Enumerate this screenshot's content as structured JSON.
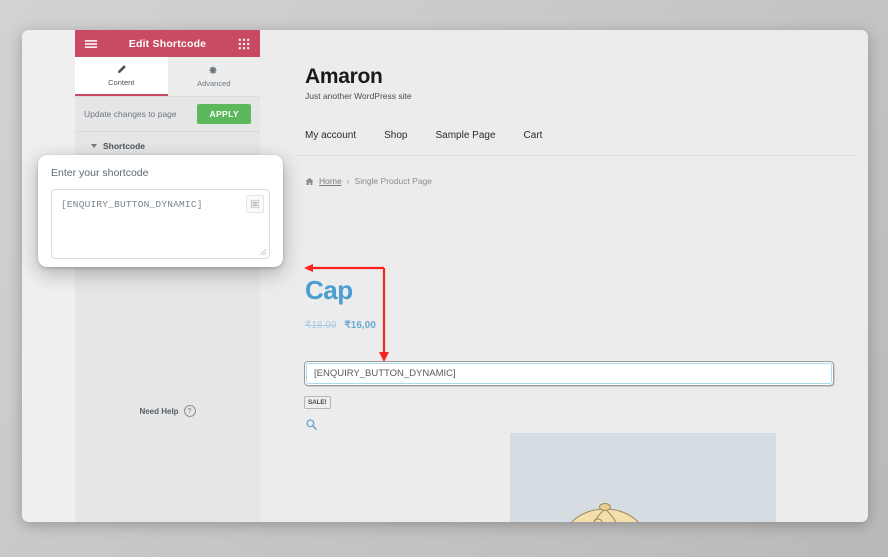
{
  "editor": {
    "header": {
      "title": "Edit Shortcode",
      "menu_icon": "hamburger-menu-icon",
      "grid_icon": "grid-apps-icon"
    },
    "tabs": [
      {
        "label": "Content",
        "icon": "pencil-icon",
        "active": true
      },
      {
        "label": "Advanced",
        "icon": "gear-icon",
        "active": false
      }
    ],
    "update_row": {
      "label": "Update changes to page",
      "apply_label": "APPLY"
    },
    "section": {
      "title": "Shortcode",
      "caret_icon": "chevron-down-icon"
    },
    "need_help": {
      "label": "Need Help",
      "icon": "question-circle-icon"
    },
    "collapse_handle": "‹"
  },
  "popover": {
    "label": "Enter your shortcode",
    "textarea_value": "[ENQUIRY_BUTTON_DYNAMIC]",
    "textarea_placeholder": "Enter your shortcode",
    "action_icon": "list-stack-icon",
    "resize_icon": "resize-grip-icon"
  },
  "preview": {
    "site_title": "Amaron",
    "site_tagline": "Just another WordPress site",
    "nav": [
      {
        "label": "My account"
      },
      {
        "label": "Shop"
      },
      {
        "label": "Sample Page"
      },
      {
        "label": "Cart"
      }
    ],
    "breadcrumb": {
      "home_icon": "home-icon",
      "home_label": "Home",
      "separator": "›",
      "current": "Single Product Page"
    },
    "product": {
      "title": "Cap",
      "price_old": "₹18,00",
      "price_new": "₹16,00",
      "shortcode_field_value": "[ENQUIRY_BUTTON_DYNAMIC]",
      "shortcode_field_placeholder": "[ENQUIRY_BUTTON_DYNAMIC]",
      "sale_badge": "SALE!",
      "zoom_icon": "magnifier-icon",
      "image_alt": "cap-product-illustration"
    }
  },
  "annotation": {
    "color": "#ff2020",
    "shape": "elbow-arrow-double-head"
  }
}
